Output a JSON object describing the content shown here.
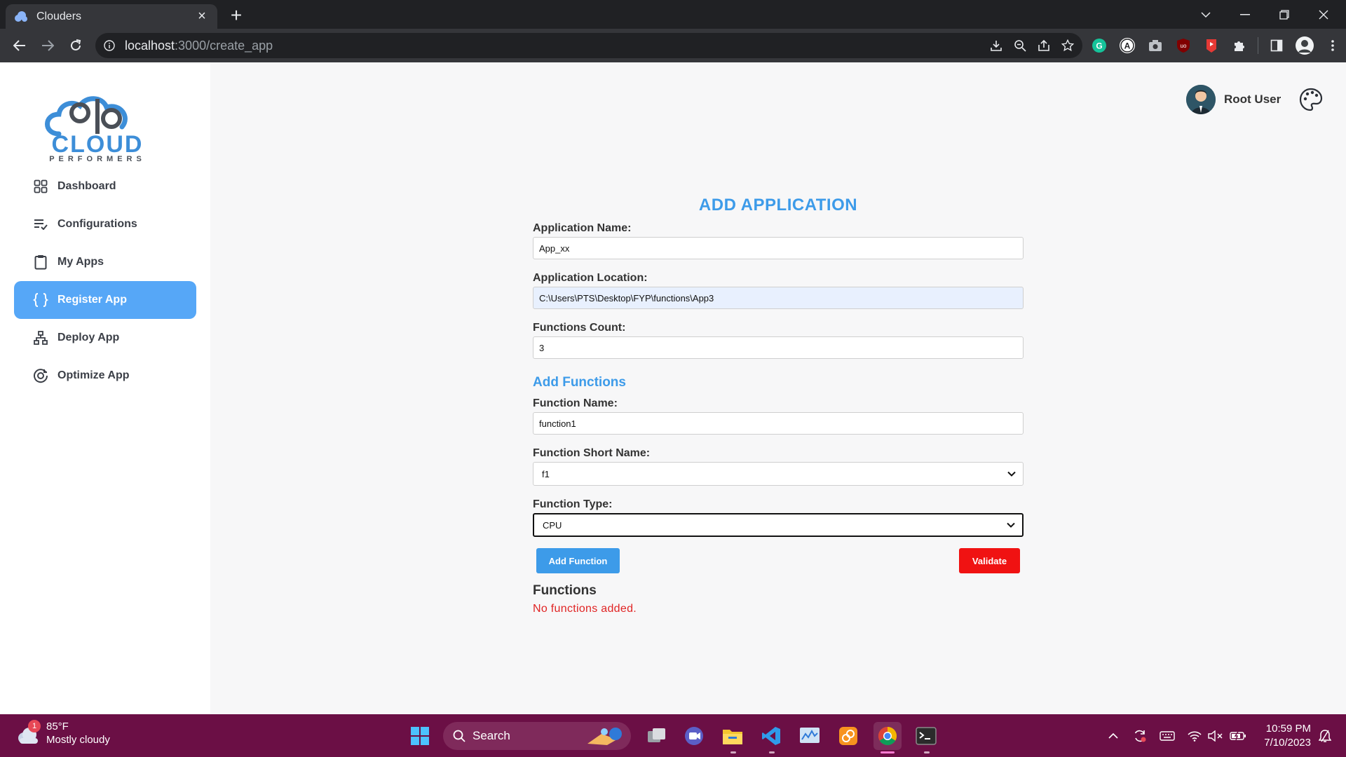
{
  "browser": {
    "tab_title": "Clouders",
    "url_host": "localhost",
    "url_path": ":3000/create_app"
  },
  "sidebar": {
    "logo_text": "CLOUD",
    "logo_subtext": "PERFORMERS",
    "items": [
      {
        "label": "Dashboard",
        "icon": "grid-icon",
        "active": false
      },
      {
        "label": "Configurations",
        "icon": "list-check-icon",
        "active": false
      },
      {
        "label": "My Apps",
        "icon": "clipboard-icon",
        "active": false
      },
      {
        "label": "Register App",
        "icon": "braces-icon",
        "active": true
      },
      {
        "label": "Deploy App",
        "icon": "sitemap-icon",
        "active": false
      },
      {
        "label": "Optimize App",
        "icon": "target-icon",
        "active": false
      }
    ],
    "active_color": "#56a7f7"
  },
  "header": {
    "user_name": "Root User",
    "theme_icon": "palette-icon"
  },
  "form": {
    "title": "ADD APPLICATION",
    "app_name_label": "Application Name:",
    "app_name_value": "App_xx",
    "app_location_label": "Application Location:",
    "app_location_value": "C:\\Users\\PTS\\Desktop\\FYP\\functions\\App3",
    "functions_count_label": "Functions Count:",
    "functions_count_value": "3",
    "add_functions_title": "Add Functions",
    "function_name_label": "Function Name:",
    "function_name_value": "function1",
    "function_short_name_label": "Function Short Name:",
    "function_short_name_value": "f1",
    "function_type_label": "Function Type:",
    "function_type_value": "CPU",
    "add_function_button": "Add Function",
    "validate_button": "Validate",
    "functions_title": "Functions",
    "empty_message": "No functions added.",
    "accent_color": "#3d9be9",
    "validate_color": "#f01212"
  },
  "taskbar": {
    "weather_badge": "1",
    "weather_temp": "85°F",
    "weather_desc": "Mostly cloudy",
    "search_label": "Search",
    "time": "10:59 PM",
    "date": "7/10/2023",
    "background": "#6b0f45"
  }
}
